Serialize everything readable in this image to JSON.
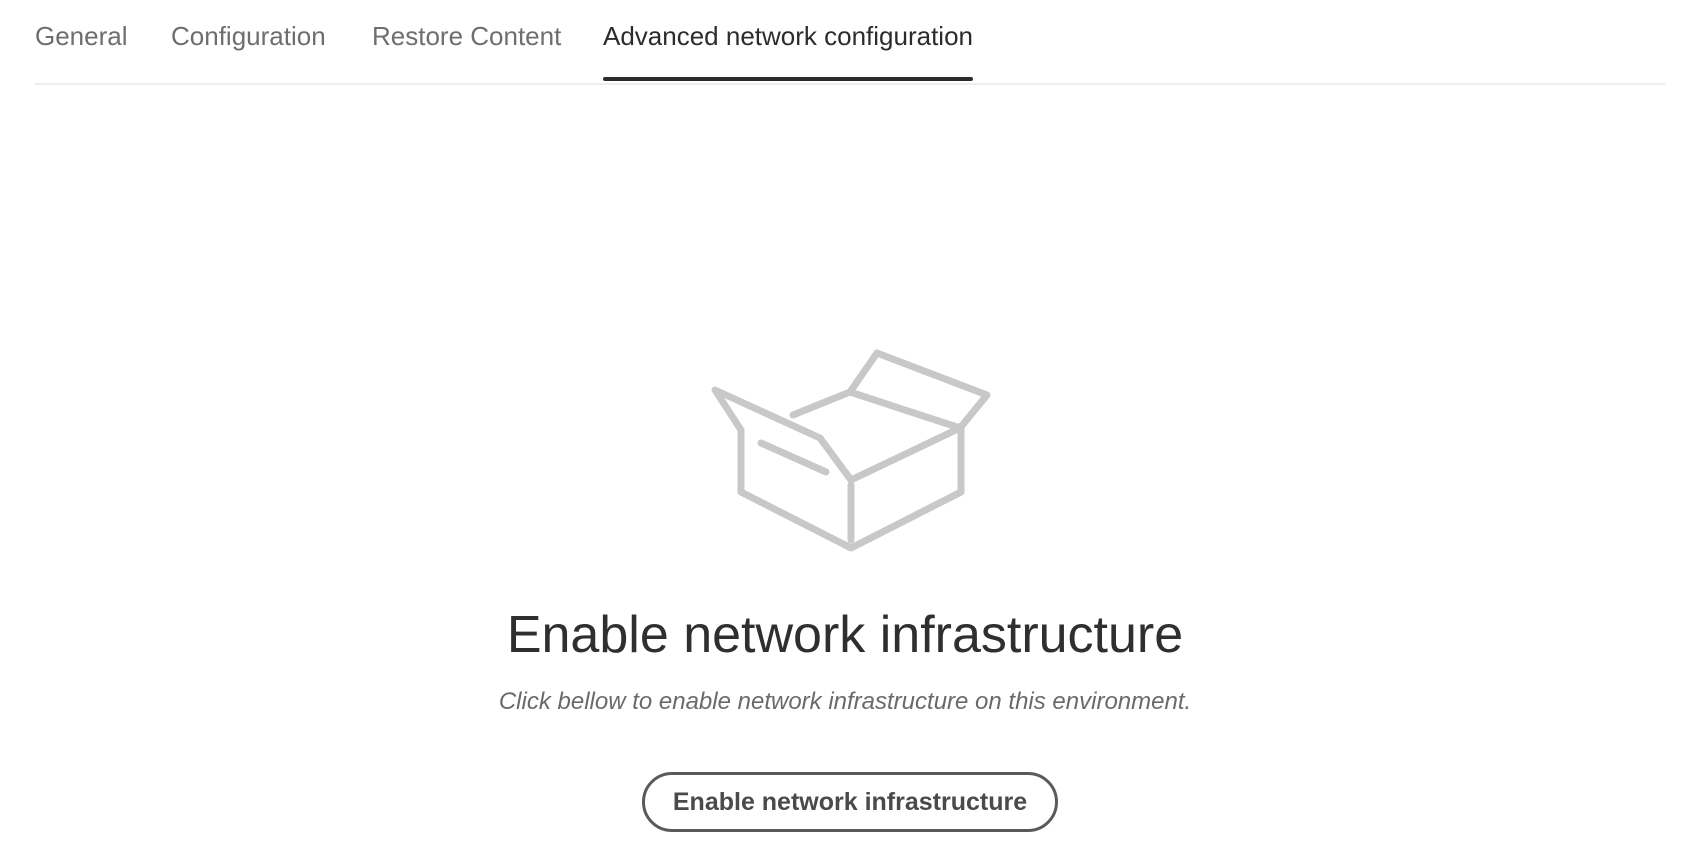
{
  "tabs": [
    {
      "label": "General",
      "active": false
    },
    {
      "label": "Configuration",
      "active": false
    },
    {
      "label": "Restore Content",
      "active": false
    },
    {
      "label": "Advanced network configuration",
      "active": true
    }
  ],
  "empty_state": {
    "icon": "open-box-icon",
    "heading": "Enable network infrastructure",
    "description": "Click bellow to enable network infrastructure on this environment.",
    "button_label": "Enable network infrastructure"
  },
  "colors": {
    "active_tab": "#2c2c2c",
    "inactive_tab": "#6e6e6e",
    "illustration": "#c8c8c8",
    "button_border": "#5a5a5a"
  }
}
